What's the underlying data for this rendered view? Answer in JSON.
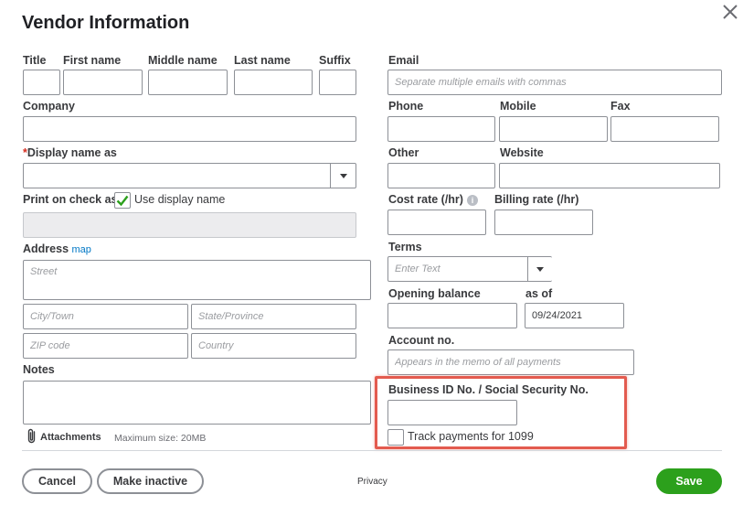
{
  "dialog": {
    "title": "Vendor Information"
  },
  "labels": {
    "title": "Title",
    "first_name": "First name",
    "middle_name": "Middle name",
    "last_name": "Last name",
    "suffix": "Suffix",
    "email": "Email",
    "company": "Company",
    "phone": "Phone",
    "mobile": "Mobile",
    "fax": "Fax",
    "display_name_required": "*",
    "display_name": "Display name as",
    "other": "Other",
    "website": "Website",
    "print_on_check": "Print on check as",
    "use_display_name": "Use display name",
    "cost_rate": "Cost rate (/hr)",
    "billing_rate": "Billing rate (/hr)",
    "address": "Address",
    "map_link": "map",
    "terms": "Terms",
    "opening_balance": "Opening balance",
    "as_of": "as of",
    "account_no": "Account no.",
    "notes": "Notes",
    "business_id": "Business ID No. / Social Security No.",
    "track_1099": "Track payments for 1099",
    "attachments": "Attachments",
    "max_size": "Maximum size: 20MB"
  },
  "placeholders": {
    "email": "Separate multiple emails with commas",
    "street": "Street",
    "city": "City/Town",
    "state": "State/Province",
    "zip": "ZIP code",
    "country": "Country",
    "terms": "Enter Text",
    "account_no": "Appears in the memo of all payments"
  },
  "values": {
    "as_of_date": "09/24/2021",
    "use_display_name_checked": true,
    "track_1099_checked": false
  },
  "footer": {
    "cancel": "Cancel",
    "make_inactive": "Make inactive",
    "privacy": "Privacy",
    "save": "Save"
  },
  "colors": {
    "primary_green": "#2ca01c",
    "link_blue": "#0077c5",
    "highlight_red": "#e35b4f"
  }
}
